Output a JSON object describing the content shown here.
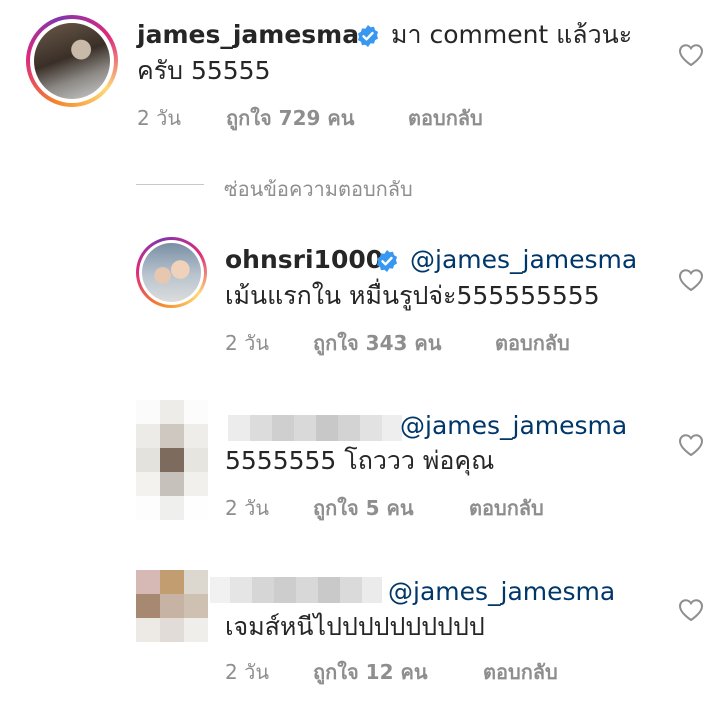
{
  "comments": [
    {
      "username": "james_jamesma",
      "text_line1": "มา comment แล้วนะ",
      "text_line2": "ครับ 55555",
      "time": "2 วัน",
      "likes": "ถูกใจ 729 คน",
      "reply": "ตอบกลับ",
      "verified": true
    },
    {
      "username": "ohnsri1000",
      "mention": "@james_jamesma",
      "text": "เม้นแรกใน หมื่นรูปจ่ะ555555555",
      "time": "2 วัน",
      "likes": "ถูกใจ 343 คน",
      "reply": "ตอบกลับ",
      "verified": true
    },
    {
      "username_hidden": true,
      "mention": "@james_jamesma",
      "text": "5555555 โถววว พ่อคุณ",
      "time": "2 วัน",
      "likes": "ถูกใจ 5 คน",
      "reply": "ตอบกลับ"
    },
    {
      "username_hidden": true,
      "mention": "@james_jamesma",
      "text": "เจมส์หนีไปปปปปปปปปป",
      "time": "2 วัน",
      "likes": "ถูกใจ 12 คน",
      "reply": "ตอบกลับ"
    }
  ],
  "hide_replies_label": "ซ่อนข้อความตอบกลับ",
  "colors": {
    "text": "#262626",
    "muted": "#8e8e8e",
    "mention": "#00376b",
    "verified": "#3897f0",
    "heart_stroke": "#8e8e8e"
  },
  "icons": {
    "like": "heart-outline-icon",
    "verified": "verified-badge-icon"
  }
}
